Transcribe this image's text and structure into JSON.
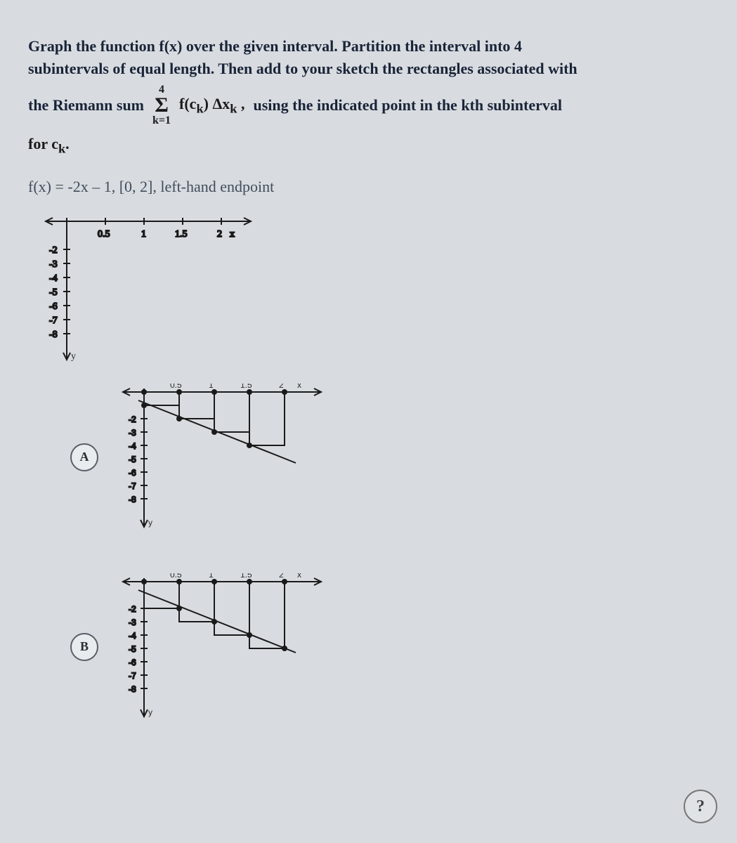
{
  "question": {
    "line1": "Graph the function f(x) over the given interval. Partition the interval into 4",
    "line2": "subintervals of equal length. Then add to your sketch the rectangles associated with",
    "sum_lead": "the Riemann sum",
    "sum_upper": "4",
    "sum_sigma": "Σ",
    "sum_lower": "k=1",
    "sum_body": "f(c_k) Δx_k ,",
    "sum_tail": "using the indicated point in the kth subinterval",
    "for_label": "for c",
    "for_sub": "k",
    "for_dot": "."
  },
  "func": "f(x) = -2x – 1, [0, 2], left-hand endpoint",
  "axes": {
    "x_ticks": [
      "0.5",
      "1",
      "1.5",
      "2"
    ],
    "x_label": "x",
    "y_ticks": [
      "-2",
      "-3",
      "-4",
      "-5",
      "-6",
      "-7",
      "-8"
    ],
    "y_label": "y"
  },
  "options": {
    "A": {
      "label": "A"
    },
    "B": {
      "label": "B"
    }
  },
  "chart_data": {
    "type": "line",
    "function": "f(x) = -2x - 1",
    "interval": [
      0,
      2
    ],
    "subintervals": 4,
    "endpoint": "left",
    "series": [
      {
        "name": "f",
        "x": [
          0,
          0.5,
          1,
          1.5,
          2
        ],
        "y": [
          -1,
          -2,
          -3,
          -4,
          -5
        ]
      }
    ],
    "option_A_riemann": {
      "left_points": [
        0,
        0.5,
        1,
        1.5
      ],
      "heights": [
        -1,
        -2,
        -3,
        -4
      ],
      "width": 0.5
    },
    "option_B_riemann": {
      "left_points": [
        0,
        0.5,
        1,
        1.5
      ],
      "heights": [
        -2,
        -3,
        -4,
        -5
      ],
      "width": 0.5
    },
    "xlabel": "x",
    "ylabel": "y",
    "xlim": [
      0,
      2
    ],
    "ylim": [
      -8,
      0
    ]
  },
  "help": "?"
}
